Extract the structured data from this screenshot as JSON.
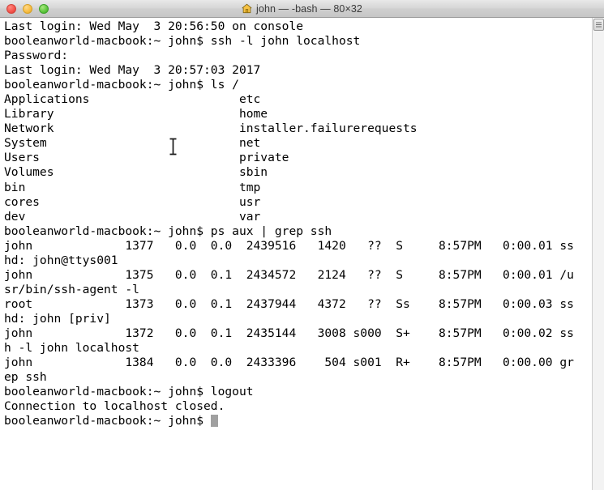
{
  "window": {
    "title": "john — -bash — 80×32",
    "icon": "home-icon",
    "traffic_lights": {
      "close": "close-button",
      "minimize": "minimize-button",
      "maximize": "maximize-button"
    },
    "colors": {
      "background": "#ffffff",
      "text": "#000000",
      "titlebar": "#d6d6d6",
      "cursor": "#a0a0a0",
      "close": "#f4524a",
      "minimize": "#f7bc3f",
      "maximize": "#5cc63c"
    },
    "size": {
      "columns": 80,
      "rows": 32
    }
  },
  "terminal": {
    "lines": [
      "Last login: Wed May  3 20:56:50 on console",
      "booleanworld-macbook:~ john$ ssh -l john localhost",
      "Password:",
      "Last login: Wed May  3 20:57:03 2017",
      "booleanworld-macbook:~ john$ ls /",
      "Applications                     etc",
      "Library                          home",
      "Network                          installer.failurerequests",
      "System                           net",
      "Users                            private",
      "Volumes                          sbin",
      "bin                              tmp",
      "cores                            usr",
      "dev                              var",
      "booleanworld-macbook:~ john$ ps aux | grep ssh",
      "john             1377   0.0  0.0  2439516   1420   ??  S     8:57PM   0:00.01 ss",
      "hd: john@ttys001",
      "john             1375   0.0  0.1  2434572   2124   ??  S     8:57PM   0:00.01 /u",
      "sr/bin/ssh-agent -l",
      "root             1373   0.0  0.1  2437944   4372   ??  Ss    8:57PM   0:00.03 ss",
      "hd: john [priv]",
      "john             1372   0.0  0.1  2435144   3008 s000  S+    8:57PM   0:00.02 ss",
      "h -l john localhost",
      "john             1384   0.0  0.0  2433396    504 s001  R+    8:57PM   0:00.00 gr",
      "ep ssh",
      "booleanworld-macbook:~ john$ logout",
      "Connection to localhost closed.",
      "booleanworld-macbook:~ john$ "
    ],
    "prompt": "booleanworld-macbook:~ john$",
    "hostname": "booleanworld-macbook",
    "user": "john",
    "cwd": "~",
    "cursor": "block"
  },
  "scrollbar": {
    "name": "vertical-scrollbar",
    "thumb_position": "top"
  }
}
